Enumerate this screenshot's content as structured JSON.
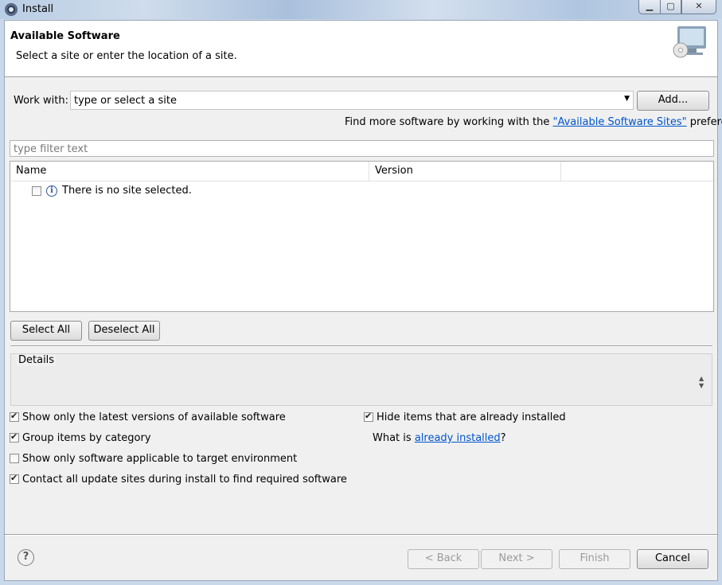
{
  "window": {
    "title": "Install"
  },
  "header": {
    "title": "Available Software",
    "subtitle": "Select a site or enter the location of a site."
  },
  "work_with": {
    "label": "Work with:",
    "value": "type or select a site",
    "add_button": "Add..."
  },
  "find_more": {
    "prefix": "Find more software by working with the ",
    "link": "\"Available Software Sites\"",
    "suffix": " preferences."
  },
  "filter": {
    "placeholder": "type filter text"
  },
  "table": {
    "columns": [
      "Name",
      "Version"
    ],
    "rows": [
      {
        "name": "There is no site selected.",
        "checked": false
      }
    ]
  },
  "selection_buttons": {
    "select_all": "Select All",
    "deselect_all": "Deselect All"
  },
  "details": {
    "label": "Details"
  },
  "options": {
    "show_latest": {
      "label": "Show only the latest versions of available software",
      "checked": true
    },
    "group_by_category": {
      "label": "Group items by category",
      "checked": true
    },
    "target_env": {
      "label": "Show only software applicable to target environment",
      "checked": false
    },
    "contact_sites": {
      "label": "Contact all update sites during install to find required software",
      "checked": true
    },
    "hide_installed": {
      "label": "Hide items that are already installed",
      "checked": true
    },
    "what_is": {
      "prefix": "What is ",
      "link": "already installed",
      "suffix": "?"
    }
  },
  "footer": {
    "help": "?",
    "back": "< Back",
    "next": "Next >",
    "finish": "Finish",
    "cancel": "Cancel"
  }
}
